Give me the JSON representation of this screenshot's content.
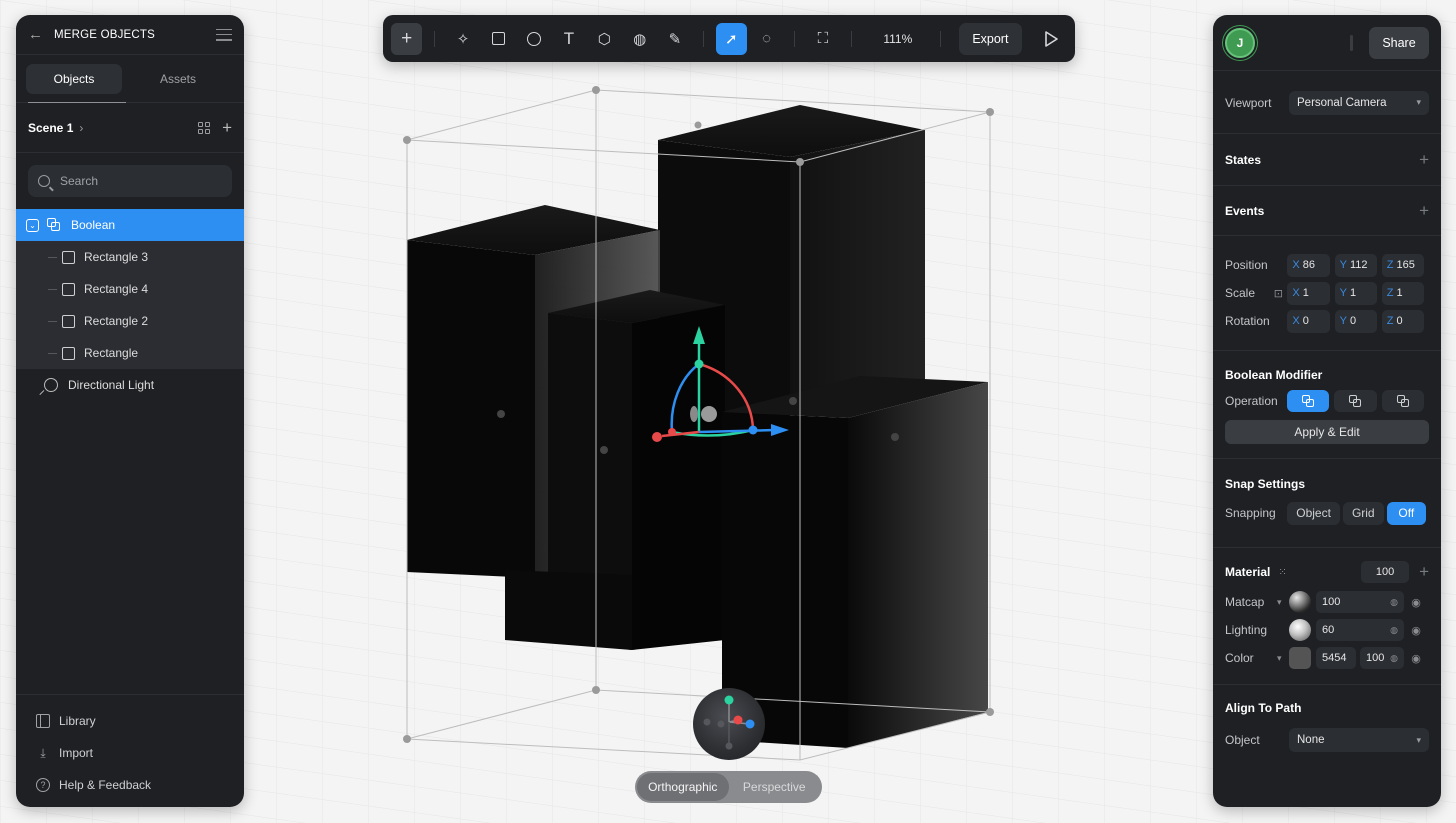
{
  "left_panel": {
    "title": "MERGE OBJECTS",
    "tabs": [
      "Objects",
      "Assets"
    ],
    "scene_label": "Scene 1",
    "search_placeholder": "Search",
    "tree": {
      "group": "Boolean",
      "children": [
        "Rectangle 3",
        "Rectangle 4",
        "Rectangle 2",
        "Rectangle"
      ],
      "light": "Directional Light"
    },
    "footer": [
      "Library",
      "Import",
      "Help & Feedback"
    ]
  },
  "toolbar": {
    "zoom": "111%",
    "export_label": "Export",
    "tools": [
      "plus-icon",
      "sparkle-icon",
      "rectangle-icon",
      "ellipse-icon",
      "text-icon",
      "cube-icon",
      "sphere-icon",
      "pen-icon",
      "select-icon",
      "comment-icon",
      "frame-icon",
      "play-icon"
    ],
    "active_tool": "select-icon",
    "accent_color": "#2e8ff3"
  },
  "right_panel": {
    "avatar_initial": "J",
    "share_label": "Share",
    "viewport_label": "Viewport",
    "viewport_value": "Personal Camera",
    "states_label": "States",
    "events_label": "Events",
    "position_label": "Position",
    "position": {
      "x": "86",
      "y": "112",
      "z": "165"
    },
    "scale_label": "Scale",
    "scale": {
      "x": "1",
      "y": "1",
      "z": "1"
    },
    "rotation_label": "Rotation",
    "rotation": {
      "x": "0",
      "y": "0",
      "z": "0"
    },
    "axis_labels": {
      "x": "X",
      "y": "Y",
      "z": "Z"
    },
    "boolean_heading": "Boolean Modifier",
    "operation_label": "Operation",
    "apply_label": "Apply & Edit",
    "snap_heading": "Snap Settings",
    "snapping_label": "Snapping",
    "snap_options": [
      "Object",
      "Grid",
      "Off"
    ],
    "snap_active": "Off",
    "material_heading": "Material",
    "material_opacity": "100",
    "matcap_label": "Matcap",
    "matcap_value": "100",
    "lighting_label": "Lighting",
    "lighting_value": "60",
    "color_label": "Color",
    "color_hex": "5454",
    "color_opacity": "100",
    "align_heading": "Align To Path",
    "object_label": "Object",
    "object_value": "None"
  },
  "viewport": {
    "projection_options": [
      "Orthographic",
      "Perspective"
    ],
    "projection_active": "Orthographic"
  }
}
